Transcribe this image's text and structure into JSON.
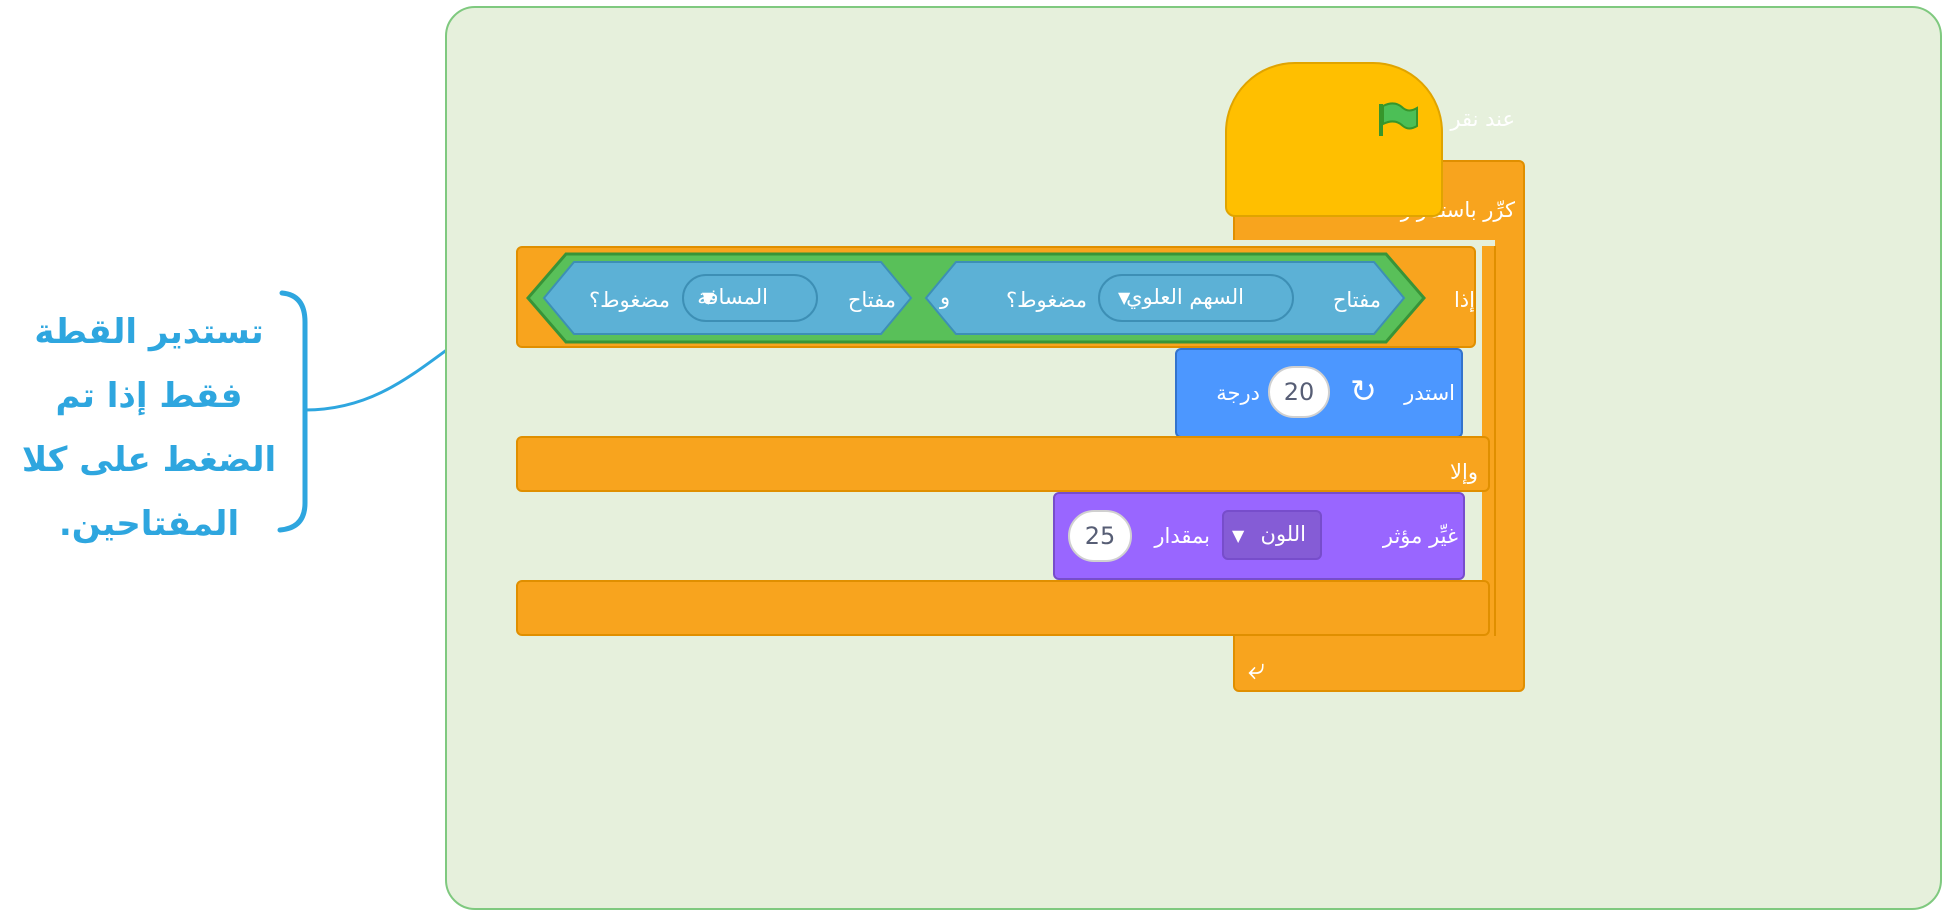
{
  "annotation": {
    "line1": "تستدير القطة",
    "line2": "فقط إذا تم",
    "line3": "الضغط على كلا",
    "line4": "المفتاحين."
  },
  "blocks": {
    "when_flag_clicked": "عند نقر",
    "forever": "كرِّر باستمرار",
    "if_label": "إذا",
    "key1_prefix": "مفتاح",
    "key1_value": "السهم العلوي",
    "key1_suffix": "مضغوط؟",
    "and_label": "و",
    "key2_prefix": "مفتاح",
    "key2_value": "المسافة",
    "key2_suffix": "مضغوط؟",
    "turn_label": "استدر",
    "turn_degrees": "20",
    "turn_unit": "درجة",
    "else_label": "وإلا",
    "change_effect_label": "غيِّر مؤثر",
    "effect_value": "اللون",
    "by_label": "بمقدار",
    "effect_amount": "25"
  },
  "colors": {
    "control": "#f8a41e",
    "events": "#ffbf00",
    "operators": "#59c059",
    "sensing": "#5cb1d6",
    "motion": "#4c97ff",
    "looks": "#9966ff",
    "annotation": "#2ea6df",
    "canvas": "#e6f0dc"
  }
}
